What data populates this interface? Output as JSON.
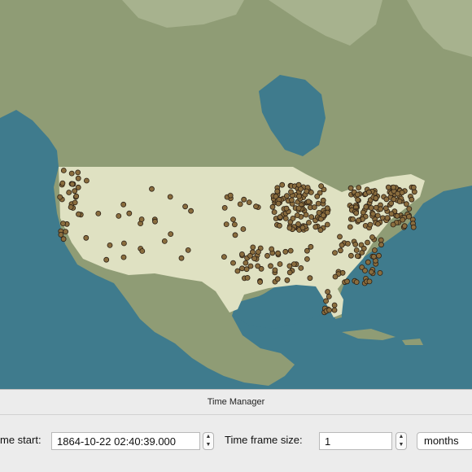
{
  "window": {
    "title": "Time Manager"
  },
  "time_start": {
    "label": "me start:",
    "value": "1864-10-22 02:40:39.000"
  },
  "time_frame": {
    "label": "Time frame size:",
    "value": "1",
    "unit": "months"
  },
  "map": {
    "colors": {
      "ocean": "#3f7b8d",
      "land": "#8f9c75",
      "land_light": "#a7b28e",
      "usa": "#dfe1c2",
      "point_fill": "#8a6d3e",
      "point_stroke": "#2b2015"
    }
  }
}
